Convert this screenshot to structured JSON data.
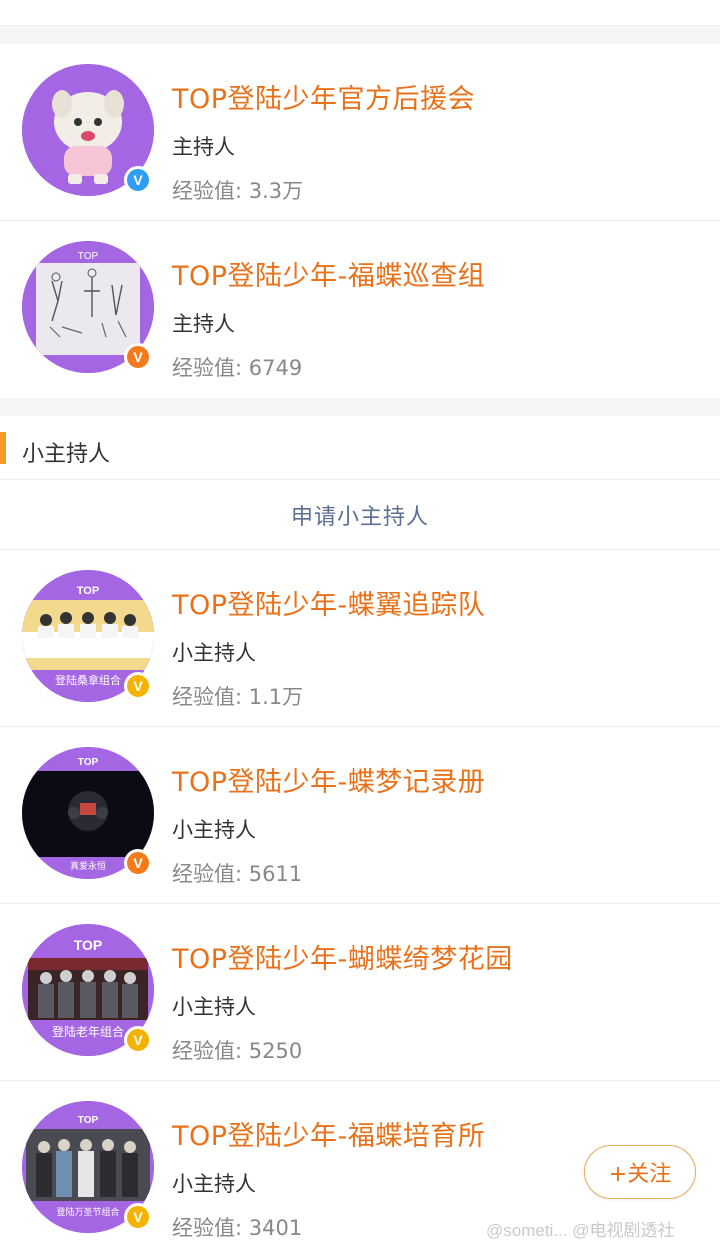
{
  "hosts": [
    {
      "name": "TOP登陆少年官方后援会",
      "role": "主持人",
      "exp": "经验值: 3.3万",
      "badge": "V",
      "badge_color": "blue",
      "avatar_icon": "plush-doll-avatar"
    },
    {
      "name": "TOP登陆少年-福蝶巡查组",
      "role": "主持人",
      "exp": "经验值: 6749",
      "badge": "V",
      "badge_color": "orange",
      "avatar_icon": "sketch-drawing-avatar",
      "avatar_text": "TOP"
    }
  ],
  "section": {
    "title": "小主持人"
  },
  "apply_label": "申请小主持人",
  "small_hosts": [
    {
      "name": "TOP登陆少年-蝶翼追踪队",
      "role": "小主持人",
      "exp": "经验值: 1.1万",
      "badge": "V",
      "badge_color": "yellow",
      "avatar_icon": "group-table-photo-avatar",
      "avatar_top": "TOP",
      "avatar_caption": "登陆桑拿组合"
    },
    {
      "name": "TOP登陆少年-蝶梦记录册",
      "role": "小主持人",
      "exp": "经验值: 5611",
      "badge": "V",
      "badge_color": "orange",
      "avatar_icon": "dark-stage-photo-avatar",
      "avatar_top": "TOP",
      "avatar_caption": "真爱永恒"
    },
    {
      "name": "TOP登陆少年-蝴蝶绮梦花园",
      "role": "小主持人",
      "exp": "经验值: 5250",
      "badge": "V",
      "badge_color": "yellow",
      "avatar_icon": "group-stage-photo-avatar",
      "avatar_top": "TOP",
      "avatar_caption": "登陆老年组合"
    },
    {
      "name": "TOP登陆少年-福蝶培育所",
      "role": "小主持人",
      "exp": "经验值: 3401",
      "badge": "V",
      "badge_color": "yellow",
      "avatar_icon": "group-hall-photo-avatar",
      "avatar_top": "TOP",
      "avatar_caption": "登陆万圣节组合"
    }
  ],
  "follow_label": "+关注",
  "watermark": "@someti... @电视剧透社",
  "colors": {
    "accent": "#e8711a",
    "avatar_bg": "#a566e4",
    "section_bar": "#f59a22",
    "link": "#5a6f92"
  }
}
